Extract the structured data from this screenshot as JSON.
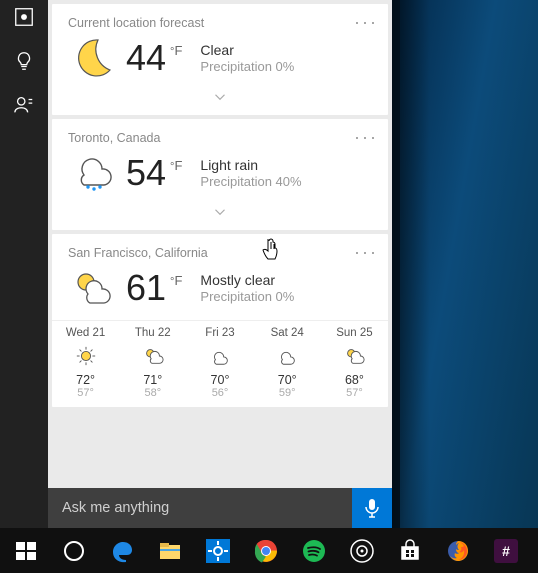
{
  "rail": {
    "icons": [
      "focus-icon",
      "tip-icon",
      "feedback-icon"
    ]
  },
  "cards": [
    {
      "title": "Current location forecast",
      "icon": "moon",
      "temp": "44",
      "unit": "°F",
      "condition": "Clear",
      "precip": "Precipitation 0%"
    },
    {
      "title": "Toronto, Canada",
      "icon": "rain",
      "temp": "54",
      "unit": "°F",
      "condition": "Light rain",
      "precip": "Precipitation 40%"
    },
    {
      "title": "San Francisco, California",
      "icon": "partly",
      "temp": "61",
      "unit": "°F",
      "condition": "Mostly clear",
      "precip": "Precipitation 0%",
      "forecast": [
        {
          "label": "Wed 21",
          "icon": "sun",
          "hi": "72°",
          "lo": "57°"
        },
        {
          "label": "Thu 22",
          "icon": "partly",
          "hi": "71°",
          "lo": "58°"
        },
        {
          "label": "Fri 23",
          "icon": "cloud",
          "hi": "70°",
          "lo": "56°"
        },
        {
          "label": "Sat 24",
          "icon": "cloud",
          "hi": "70°",
          "lo": "59°"
        },
        {
          "label": "Sun 25",
          "icon": "partly",
          "hi": "68°",
          "lo": "57°"
        }
      ]
    }
  ],
  "search": {
    "placeholder": "Ask me anything"
  },
  "taskbar": {
    "items": [
      "start",
      "cortana",
      "edge",
      "explorer",
      "settings",
      "chrome",
      "spotify",
      "groove",
      "store",
      "firefox",
      "slack"
    ]
  },
  "colors": {
    "accent": "#0078d7",
    "taskbar": "#101010",
    "search": "#3f3f3f"
  }
}
